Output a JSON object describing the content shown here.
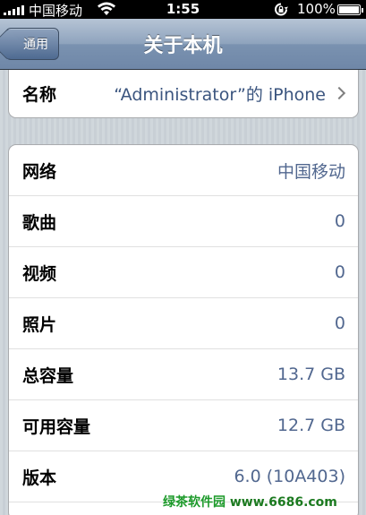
{
  "status_bar": {
    "carrier": "中国移动",
    "time": "1:55",
    "battery": "100%"
  },
  "nav": {
    "back_label": "通用",
    "title": "关于本机"
  },
  "name_row": {
    "label": "名称",
    "value": "“Administrator”的 iPhone"
  },
  "info_rows": [
    {
      "label": "网络",
      "value": "中国移动"
    },
    {
      "label": "歌曲",
      "value": "0"
    },
    {
      "label": "视频",
      "value": "0"
    },
    {
      "label": "照片",
      "value": "0"
    },
    {
      "label": "总容量",
      "value": "13.7 GB"
    },
    {
      "label": "可用容量",
      "value": "12.7 GB"
    },
    {
      "label": "版本",
      "value": "6.0 (10A403)"
    }
  ],
  "watermark": {
    "brand": "绿茶软件园",
    "url": "www.6686.com"
  }
}
